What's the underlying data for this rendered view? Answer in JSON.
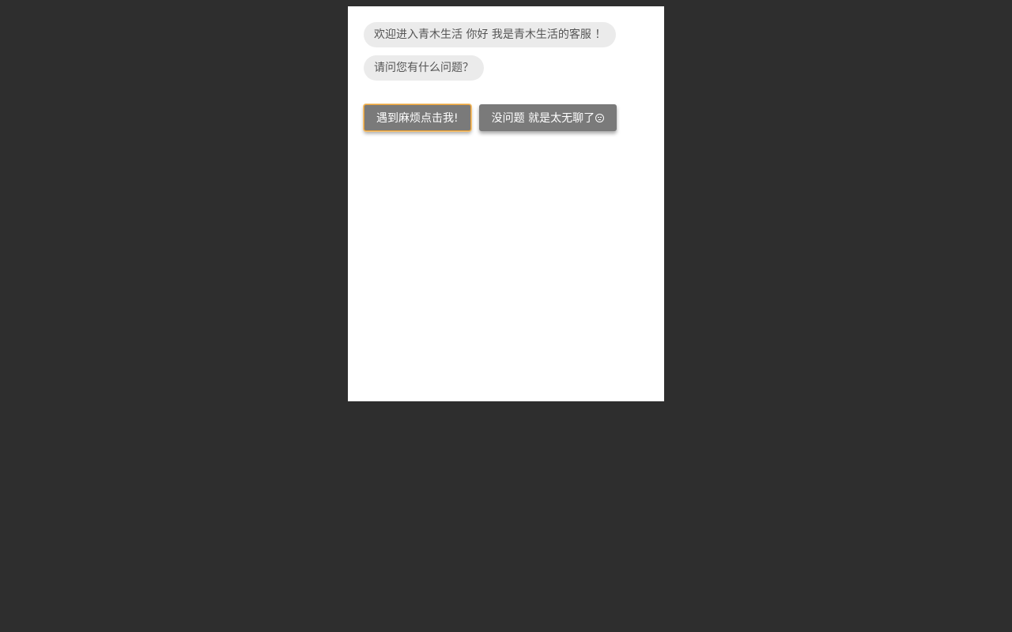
{
  "chat": {
    "messages": [
      "欢迎进入青木生活 你好 我是青木生活的客服 ！",
      "请问您有什么问题？"
    ],
    "buttons": {
      "trouble_label": "遇到麻烦点击我!",
      "bored_label": "没问题 就是太无聊了"
    },
    "bored_icon": "neutral-face-icon"
  },
  "colors": {
    "page_background": "#2e2e2e",
    "panel_background": "#ffffff",
    "bubble_background": "#ebebeb",
    "button_background": "#7a7a7a",
    "focus_outline": "#e8a13a"
  }
}
